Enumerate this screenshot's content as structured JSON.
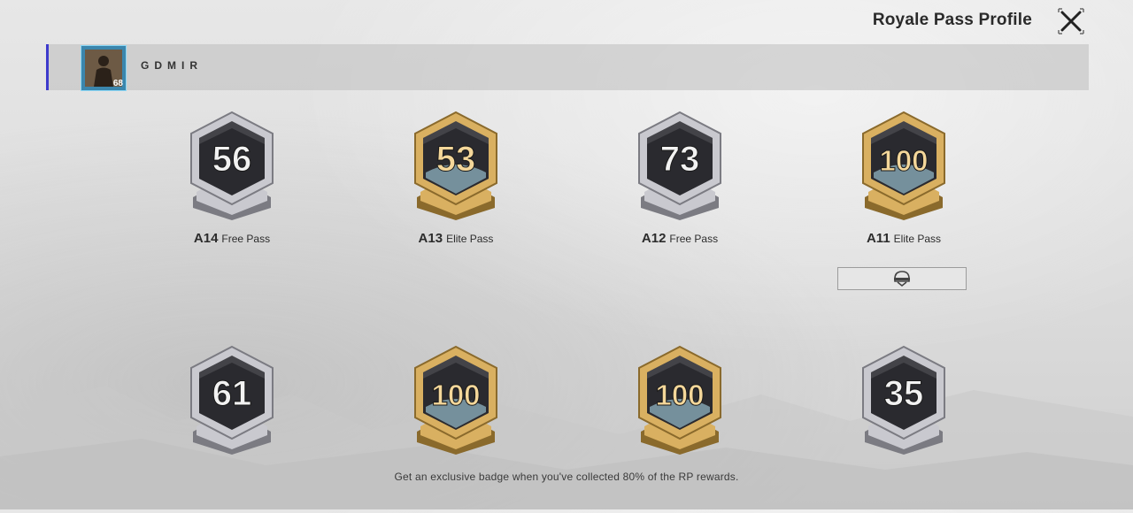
{
  "header": {
    "title": "Royale Pass Profile"
  },
  "profile": {
    "name": "GDMIR",
    "avatar_level": "68"
  },
  "badges": [
    {
      "level": "56",
      "season": "A14",
      "pass": "Free Pass",
      "style": "silver"
    },
    {
      "level": "53",
      "season": "A13",
      "pass": "Elite Pass",
      "style": "gold"
    },
    {
      "level": "73",
      "season": "A12",
      "pass": "Free Pass",
      "style": "silver"
    },
    {
      "level": "100",
      "season": "A11",
      "pass": "Elite Pass",
      "style": "gold"
    },
    {
      "level": "61",
      "season": "",
      "pass": "",
      "style": "silver"
    },
    {
      "level": "100",
      "season": "",
      "pass": "",
      "style": "gold"
    },
    {
      "level": "100",
      "season": "",
      "pass": "",
      "style": "gold"
    },
    {
      "level": "35",
      "season": "",
      "pass": "",
      "style": "silver"
    }
  ],
  "collect_button": {
    "icon": "helmet-badge-icon"
  },
  "footer": {
    "note": "Get an exclusive badge when you've collected 80% of the RP rewards."
  },
  "colors": {
    "accent": "#3d3acc",
    "silver_frame": "#c9c9cf",
    "gold_frame": "#d9b061",
    "badge_core": "#2a2a2f"
  }
}
